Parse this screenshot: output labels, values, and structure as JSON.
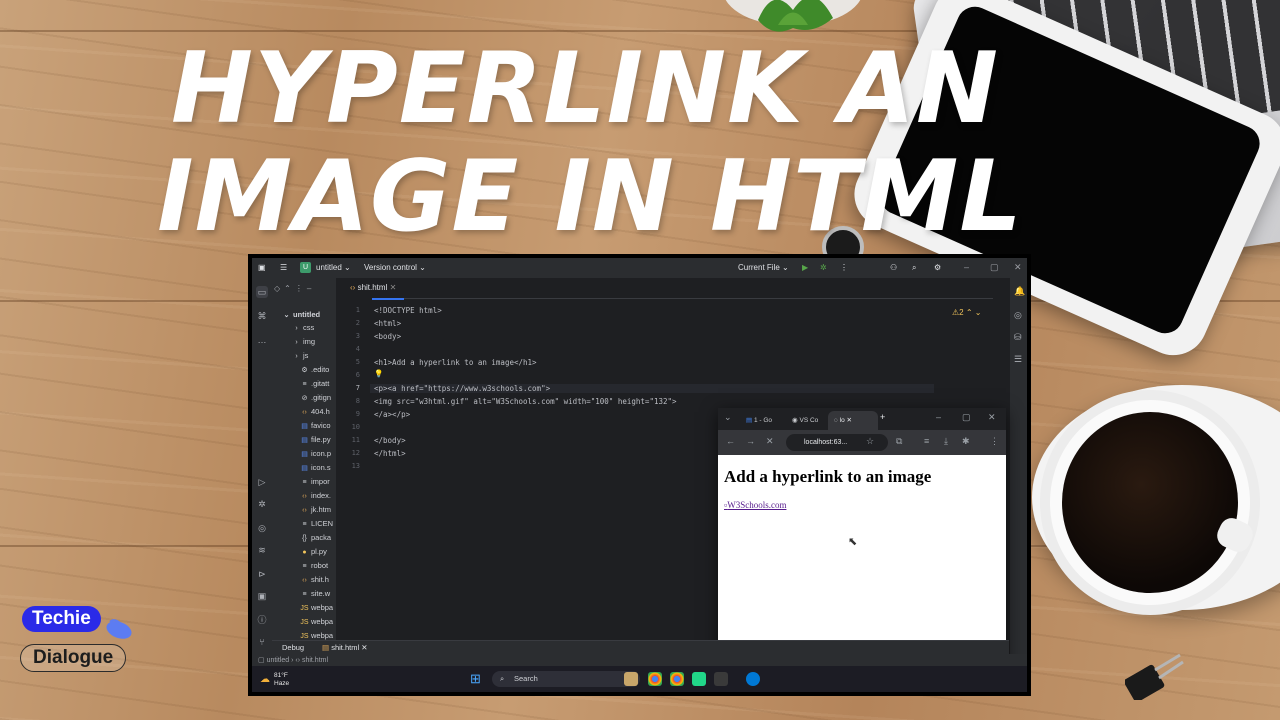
{
  "headline": {
    "line1": "HYPERLINK AN",
    "line2": "IMAGE IN HTML"
  },
  "brand": {
    "top": "Techie",
    "bottom": "Dialogue"
  },
  "ide": {
    "project_name": "untitled",
    "project_badge": "U",
    "vcs_label": "Version control",
    "run_config": "Current File",
    "active_tab": "shit.html",
    "warning_count": "2",
    "tree": {
      "root": "untitled",
      "items": [
        "css",
        "img",
        "js",
        ".edito",
        ".gitatt",
        ".gitign",
        "404.h",
        "favico",
        "file.py",
        "icon.p",
        "icon.s",
        "impor",
        "index.",
        "jk.htm",
        "LICEN",
        "packa",
        "pl.py",
        "robot",
        "shit.h",
        "site.w",
        "webpa",
        "webpa",
        "webpa"
      ]
    },
    "code_lines": [
      {
        "n": "1",
        "text": "<!DOCTYPE html>"
      },
      {
        "n": "2",
        "text": "<html>"
      },
      {
        "n": "3",
        "text": "<body>"
      },
      {
        "n": "4",
        "text": ""
      },
      {
        "n": "5",
        "text": "<h1>Add a hyperlink to an image</h1>"
      },
      {
        "n": "6",
        "text": ""
      },
      {
        "n": "7",
        "text": "<p><a href=\"https://www.w3schools.com\">"
      },
      {
        "n": "8",
        "text": "<img src=\"w3html.gif\" alt=\"W3Schools.com\" width=\"100\" height=\"132\">"
      },
      {
        "n": "9",
        "text": "</a></p>"
      },
      {
        "n": "10",
        "text": ""
      },
      {
        "n": "11",
        "text": "</body>"
      },
      {
        "n": "12",
        "text": "</html>"
      },
      {
        "n": "13",
        "text": ""
      }
    ],
    "debug_tab": "Debug",
    "debug_file": "shit.html",
    "breadcrumb_root": "untitled",
    "breadcrumb_file": "shit.html"
  },
  "taskbar": {
    "temperature": "81°F",
    "condition": "Haze",
    "search_placeholder": "Search"
  },
  "browser": {
    "tabs": [
      "1 - Go",
      "VS Co",
      "lo"
    ],
    "address": "localhost:63...",
    "page_heading": "Add a hyperlink to an image",
    "link_alt_text": "W3Schools.com"
  }
}
